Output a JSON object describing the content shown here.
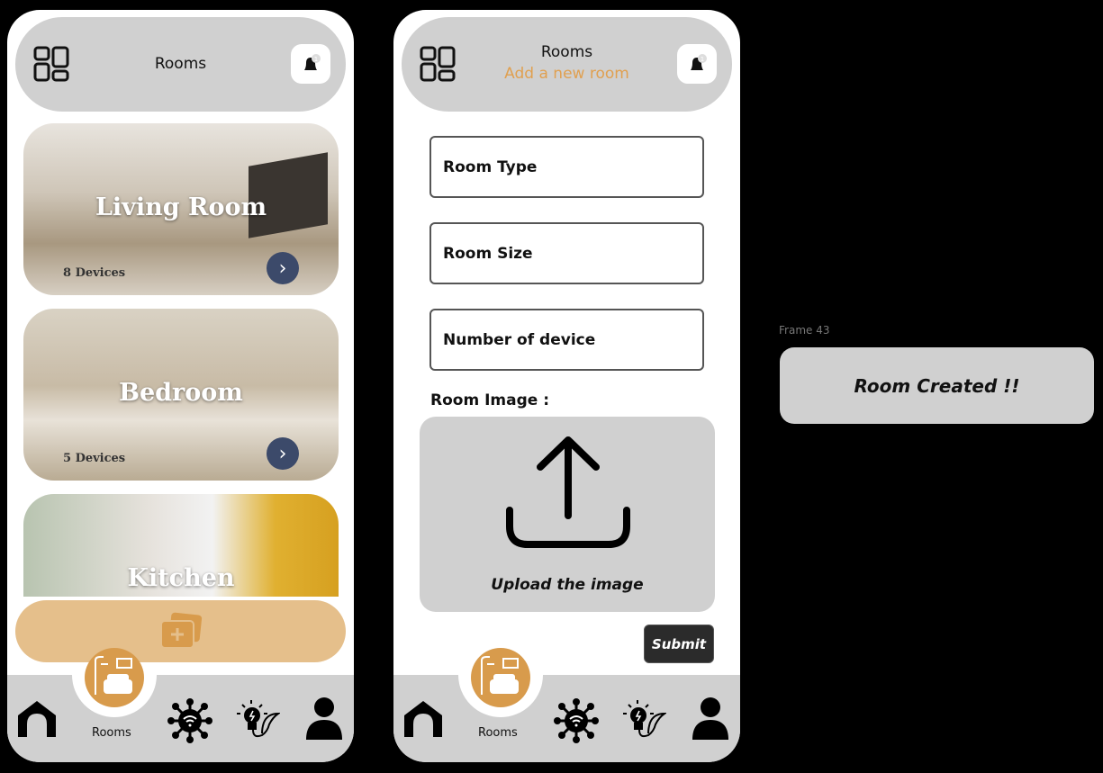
{
  "screen1": {
    "header": {
      "title": "Rooms",
      "notification_count": "1"
    },
    "rooms": [
      {
        "name": "Living Room",
        "devices": "8 Devices"
      },
      {
        "name": "Bedroom",
        "devices": "5 Devices"
      },
      {
        "name": "Kitchen"
      }
    ],
    "nav": {
      "rooms_label": "Rooms"
    }
  },
  "screen2": {
    "header": {
      "title": "Rooms",
      "subtitle": "Add a new room",
      "notification_count": "1"
    },
    "form": {
      "room_type": "Room Type",
      "room_size": "Room Size",
      "num_devices": "Number of device",
      "image_label": "Room Image :",
      "upload_label": "Upload the image",
      "submit": "Submit"
    },
    "nav": {
      "rooms_label": "Rooms"
    }
  },
  "frame": {
    "label": "Frame 43",
    "message": "Room Created !!"
  },
  "colors": {
    "accent": "#d89b4c",
    "header_bg": "#d0d0d0",
    "add_bar": "#e5bf8b"
  }
}
